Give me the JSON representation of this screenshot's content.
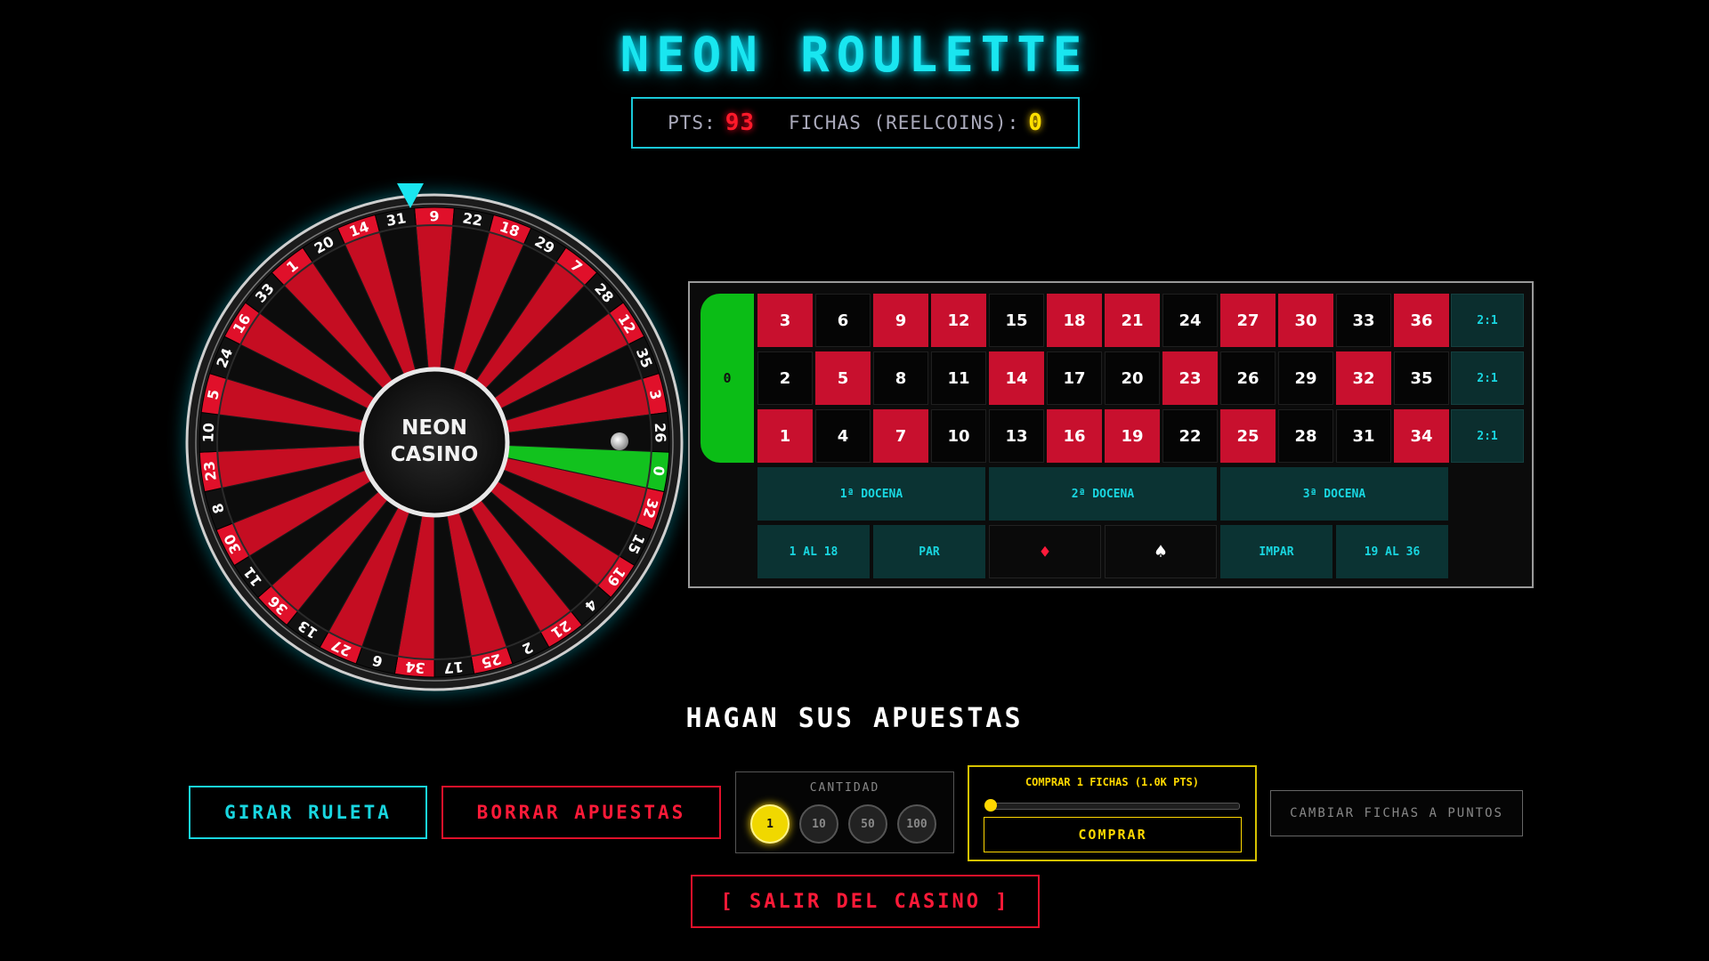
{
  "header": {
    "title": "NEON ROULETTE",
    "pts_label": "PTS:",
    "pts_value": "93",
    "coins_label": "FICHAS (REELCOINS):",
    "coins_value": "0"
  },
  "wheel": {
    "center_line1": "NEON",
    "center_line2": "CASINO",
    "sequence": [
      "9",
      "22",
      "18",
      "29",
      "7",
      "28",
      "12",
      "35",
      "3",
      "26",
      "0",
      "32",
      "15",
      "19",
      "4",
      "21",
      "2",
      "25",
      "17",
      "34",
      "6",
      "27",
      "13",
      "36",
      "11",
      "30",
      "8",
      "23",
      "10",
      "5",
      "24",
      "16",
      "33",
      "1",
      "20",
      "14",
      "31"
    ],
    "red_numbers": [
      "1",
      "3",
      "5",
      "7",
      "9",
      "12",
      "14",
      "16",
      "18",
      "19",
      "21",
      "23",
      "25",
      "27",
      "30",
      "32",
      "34",
      "36"
    ],
    "highlighted": "0",
    "colors": {
      "red": "#e0102a",
      "black": "#111111",
      "green": "#12c21e",
      "glow": "#00e5ff"
    }
  },
  "board": {
    "zero_label": "0",
    "rows": [
      [
        "3",
        "6",
        "9",
        "12",
        "15",
        "18",
        "21",
        "24",
        "27",
        "30",
        "33",
        "36"
      ],
      [
        "2",
        "5",
        "8",
        "11",
        "14",
        "17",
        "20",
        "23",
        "26",
        "29",
        "32",
        "35"
      ],
      [
        "1",
        "4",
        "7",
        "10",
        "13",
        "16",
        "19",
        "22",
        "25",
        "28",
        "31",
        "34"
      ]
    ],
    "column_bets": [
      "2:1",
      "2:1",
      "2:1"
    ],
    "dozens": [
      "1ª DOCENA",
      "2ª DOCENA",
      "3ª DOCENA"
    ],
    "outside": {
      "low": "1 AL 18",
      "even": "PAR",
      "red_icon": "diamond-icon",
      "black_icon": "spade-icon",
      "odd": "IMPAR",
      "high": "19 AL 36"
    }
  },
  "status": "HAGAN SUS APUESTAS",
  "controls": {
    "spin_label": "GIRAR RULETA",
    "clear_label": "BORRAR APUESTAS",
    "amount_label": "CANTIDAD",
    "chips": [
      "1",
      "10",
      "50",
      "100"
    ],
    "selected_chip": "1",
    "buy_label": "COMPRAR 1 FICHAS (1.0K PTS)",
    "buy_slider_value": 0,
    "buy_button": "COMPRAR",
    "exchange_label": "CAMBIAR FICHAS A PUNTOS",
    "exit_label": "[ SALIR DEL CASINO ]"
  }
}
